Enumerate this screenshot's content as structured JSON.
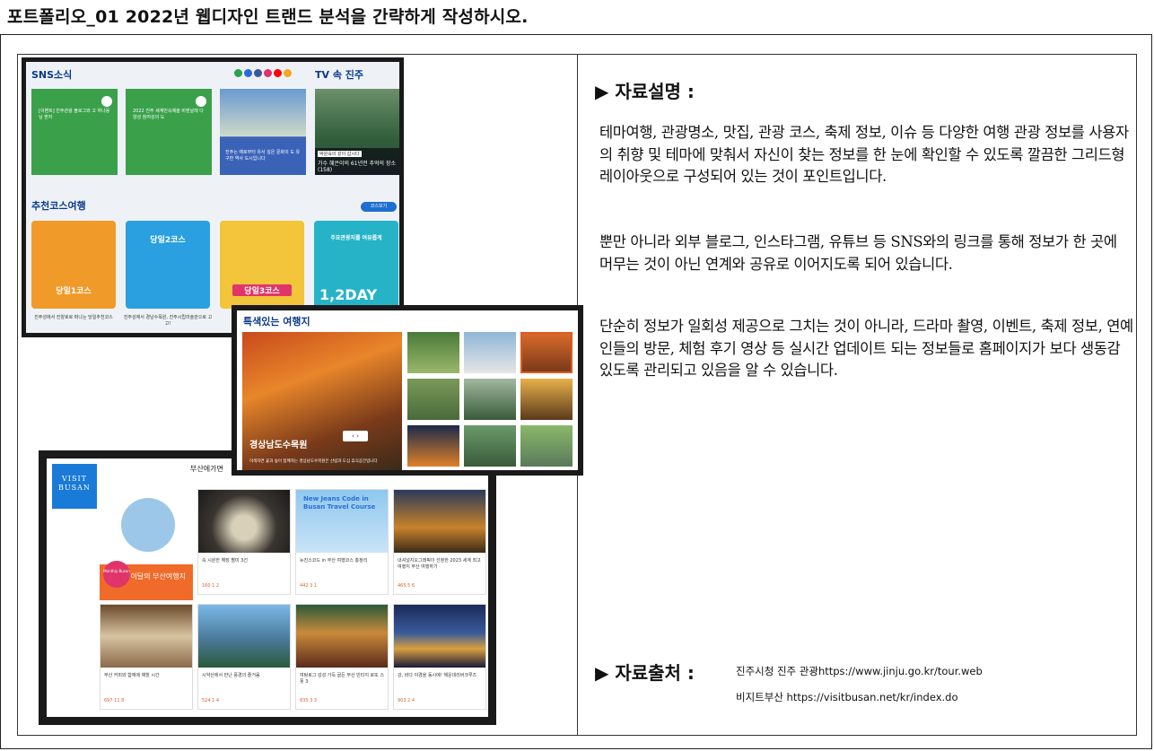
{
  "page_title": "포트폴리오_01 2022년 웹디자인 트랜드 분석을 간략하게 작성하시오.",
  "description": {
    "heading": "▶ 자료설명 :",
    "paragraphs": [
      "테마여행, 관광명소, 맛집, 관광 코스, 축제 정보, 이슈 등 다양한 여행 관광 정보를 사용자의 취향 및 테마에 맞춰서 자신이 찾는 정보를 한 눈에 확인할 수 있도록 깔끔한 그리드형 레이아웃으로 구성되어 있는 것이 포인트입니다.",
      "뿐만 아니라 외부 블로그, 인스타그램, 유튜브 등 SNS와의 링크를 통해 정보가 한 곳에 머무는 것이 아닌 연계와 공유로 이어지도록 되어 있습니다.",
      "단순히 정보가 일회성 제공으로 그치는 것이 아니라, 드라마 촬영, 이벤트, 축제 정보, 연예인들의 방문, 체험 후기 영상 등 실시간 업데이트 되는 정보들로 홈페이지가 보다 생동감 있도록 관리되고 있음을 알 수 있습니다."
    ]
  },
  "source": {
    "heading": "▶ 자료출처 :",
    "lines": [
      "진주시청 진주 관광https://www.jinju.go.kr/tour.web",
      "비지트부산 https://visitbusan.net/kr/index.do"
    ]
  },
  "shot1": {
    "sns_title": "SNS소식",
    "tv_title": "TV 속 진주",
    "sns_cards": [
      "[이벤트] 진주관광 블로그와 고 하나몽님 받자",
      "2022 진주 세계민속예술 비엔날레 다양성 참여성의 도"
    ],
    "photo_card_text": "진주는 예로부터 유서 깊은 문화의 도 유구한 역사 도시입니다",
    "tv_caption_tag": "박원숙의 같이 삽시다",
    "tv_caption": "가수 혜은이의 61년전 추억의 장소(158)",
    "course_title": "추천코스여행",
    "course_button": "코스보기",
    "courses": [
      {
        "label": "당일1코스",
        "caption": "진주성에서 진양호로 떠나는 당일추천코스"
      },
      {
        "label": "당일2코스",
        "caption": "진주성에서 경남수목원, 진주시립미술관으로 고고!"
      },
      {
        "label": "당일3코스",
        "caption": ""
      },
      {
        "label": "1,2DAY",
        "top": "주요관광지를 여유롭게",
        "caption": ""
      }
    ],
    "sns_colors": [
      "#2aa14a",
      "#2b6be0",
      "#3b5998",
      "#e1306c",
      "#ff0000",
      "#f5a623"
    ]
  },
  "shot2": {
    "title": "특색있는 여행지",
    "main_name": "경상남도수목원",
    "main_desc": "이색자연 꽃과 숲이 함께하는 경상남도수목원은 산림과 도심 휴식공간입니다",
    "arrows": "‹  ›"
  },
  "shot3": {
    "logo": "VISIT BUSAN",
    "top_text": "부산에가면",
    "feature_badge": "Monthly Busan",
    "feature_label": "이달의 부산여행지",
    "banner_text": "New Jeans Code in Busan Travel Course",
    "cards": [
      {
        "title": "속 시원한 해장 별미 3선",
        "meta": "160  1  2"
      },
      {
        "title": "뉴진스코드 in 부산 여행코스 총정리",
        "meta": "442  3  1"
      },
      {
        "title": "내셔널지오그래픽이 선정한 2023 세계 최고 여행지 부산 여행하기",
        "meta": "465  5  6"
      },
      {
        "title": "부산 커피와 함께에 채힐 시간",
        "meta": "697  11  8"
      },
      {
        "title": "시약산에서 만난 풍경의 즐거움",
        "meta": "524  1  4"
      },
      {
        "title": "여탕로그 감성 가득 골든 부산 빈티지 로또 스폿 3",
        "meta": "835  3  3"
      },
      {
        "title": "강, 바다 야경을 동시에! 해운대리버크루즈",
        "meta": "903  2  4"
      }
    ]
  }
}
